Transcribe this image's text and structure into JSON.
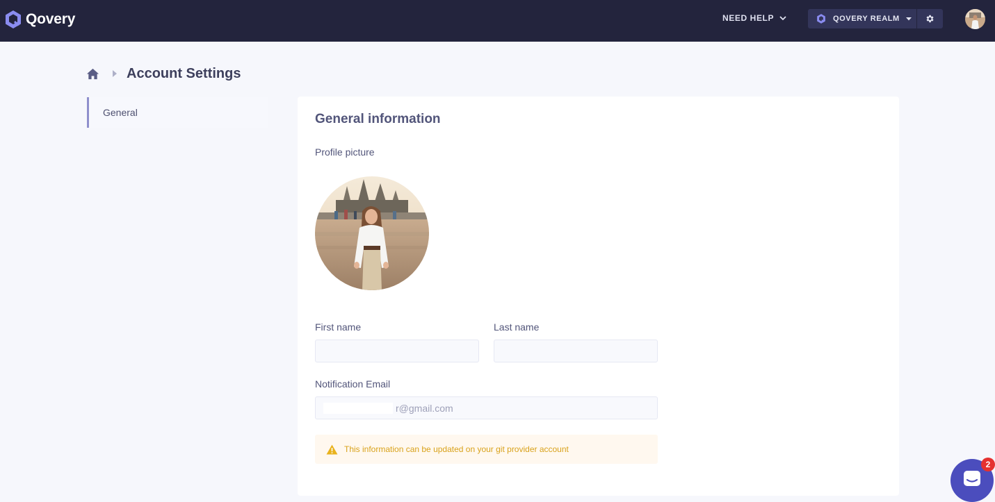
{
  "navbar": {
    "brand": "Qovery",
    "help_label": "NEED HELP",
    "org_name": "QOVERY REALM"
  },
  "breadcrumb": {
    "title": "Account Settings"
  },
  "sidebar": {
    "items": [
      {
        "label": "General",
        "active": true
      }
    ]
  },
  "form": {
    "section_title": "General information",
    "profile_picture_label": "Profile picture",
    "first_name_label": "First name",
    "first_name_value": "",
    "last_name_label": "Last name",
    "last_name_value": "",
    "email_label": "Notification Email",
    "email_visible_suffix": "r@gmail.com",
    "info_message": "This information can be updated on your git provider account"
  },
  "chat": {
    "unread_count": "2"
  },
  "colors": {
    "navbar_bg": "#23243d",
    "accent": "#8f8fcc",
    "warning_text": "#d9a21b",
    "warning_bg": "#fff8ef",
    "chat_bg": "#4b4dbd",
    "badge_bg": "#e5312f"
  },
  "icons": {
    "logo": "qovery-logo-icon",
    "help_chevron": "chevron-down-icon",
    "org_logo": "qovery-org-icon",
    "org_caret": "caret-down-icon",
    "settings": "gear-icon",
    "home": "home-icon",
    "breadcrumb_separator": "caret-right-icon",
    "warning": "warning-icon",
    "chat": "chat-icon"
  }
}
